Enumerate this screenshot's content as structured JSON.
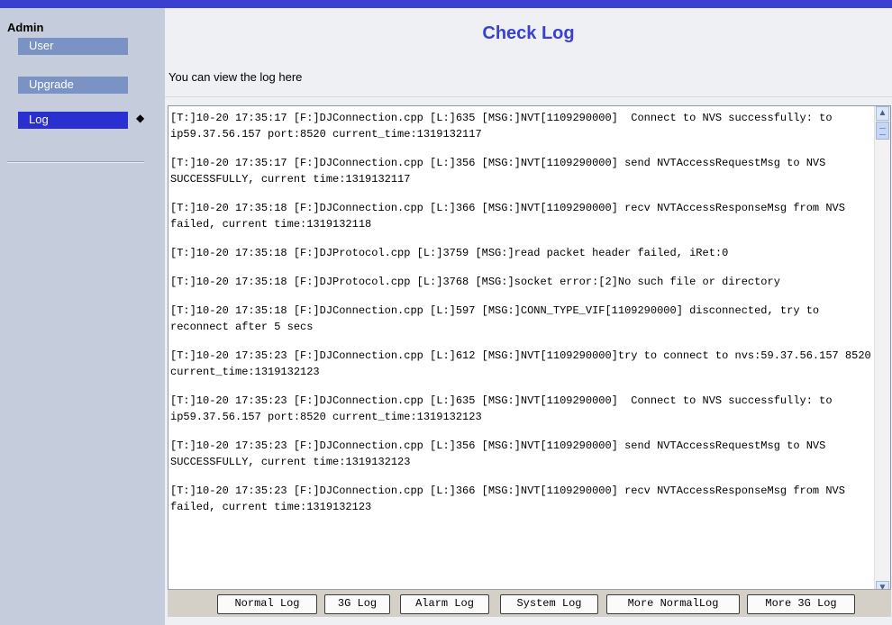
{
  "sidebar": {
    "title": "Admin",
    "items": [
      {
        "label": "User"
      },
      {
        "label": "Upgrade"
      },
      {
        "label": "Log"
      }
    ],
    "active_marker": "◆"
  },
  "main": {
    "title": "Check Log",
    "subtitle": "You can view the log here",
    "log_entries": [
      "[T:]10-20 17:35:17 [F:]DJConnection.cpp [L:]635 [MSG:]NVT[1109290000]  Connect to NVS successfully: to ip59.37.56.157 port:8520 current_time:1319132117",
      "[T:]10-20 17:35:17 [F:]DJConnection.cpp [L:]356 [MSG:]NVT[1109290000] send NVTAccessRequestMsg to NVS SUCCESSFULLY, current time:1319132117",
      "[T:]10-20 17:35:18 [F:]DJConnection.cpp [L:]366 [MSG:]NVT[1109290000] recv NVTAccessResponseMsg from NVS failed, current time:1319132118",
      "[T:]10-20 17:35:18 [F:]DJProtocol.cpp [L:]3759 [MSG:]read packet header failed, iRet:0",
      "[T:]10-20 17:35:18 [F:]DJProtocol.cpp [L:]3768 [MSG:]socket error:[2]No such file or directory",
      "[T:]10-20 17:35:18 [F:]DJConnection.cpp [L:]597 [MSG:]CONN_TYPE_VIF[1109290000] disconnected, try to reconnect after 5 secs",
      "[T:]10-20 17:35:23 [F:]DJConnection.cpp [L:]612 [MSG:]NVT[1109290000]try to connect to nvs:59.37.56.157 8520 current_time:1319132123",
      "[T:]10-20 17:35:23 [F:]DJConnection.cpp [L:]635 [MSG:]NVT[1109290000]  Connect to NVS successfully: to ip59.37.56.157 port:8520 current_time:1319132123",
      "[T:]10-20 17:35:23 [F:]DJConnection.cpp [L:]356 [MSG:]NVT[1109290000] send NVTAccessRequestMsg to NVS SUCCESSFULLY, current time:1319132123",
      "[T:]10-20 17:35:23 [F:]DJConnection.cpp [L:]366 [MSG:]NVT[1109290000] recv NVTAccessResponseMsg from NVS failed, current time:1319132123"
    ],
    "buttons": [
      {
        "label": "Normal Log"
      },
      {
        "label": "3G Log"
      },
      {
        "label": "Alarm Log"
      },
      {
        "label": "System Log"
      },
      {
        "label": "More NormalLog"
      },
      {
        "label": "More 3G Log"
      }
    ]
  },
  "colors": {
    "accent": "#3a3fd0",
    "sidebar_bg": "#c5ccdc",
    "menu_item": "#7a93c4",
    "menu_item_active": "#2a2fd2",
    "title": "#3b40d0"
  },
  "icons": {
    "scroll_up": "scroll-up-arrow-icon",
    "scroll_down": "scroll-down-arrow-icon",
    "active_marker": "diamond-icon"
  }
}
